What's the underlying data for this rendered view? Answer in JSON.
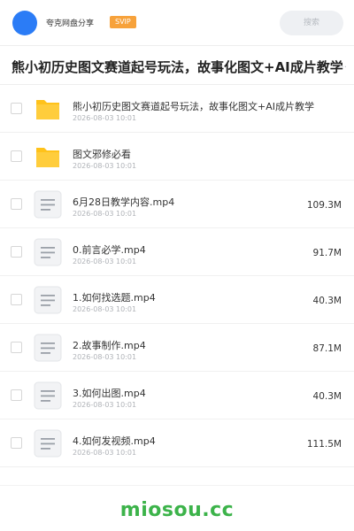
{
  "header": {
    "brand": "夸克网盘分享",
    "badge": "SVIP",
    "search_placeholder": "搜索"
  },
  "share": {
    "title": "熊小初历史图文赛道起号玩法，故事化图文+AI成片教学"
  },
  "files": [
    {
      "name": "熊小初历史图文赛道起号玩法，故事化图文+AI成片教学",
      "date": "2026-08-03 10:01",
      "size": "",
      "icon": "folder-icon"
    },
    {
      "name": "图文邪修必看",
      "date": "2026-08-03 10:01",
      "size": "",
      "icon": "folder-icon"
    },
    {
      "name": "6月28日教学内容.mp4",
      "date": "2026-08-03 10:01",
      "size": "109.3M",
      "icon": "video-file-icon"
    },
    {
      "name": "0.前言必学.mp4",
      "date": "2026-08-03 10:01",
      "size": "91.7M",
      "icon": "video-file-icon"
    },
    {
      "name": "1.如何找选题.mp4",
      "date": "2026-08-03 10:01",
      "size": "40.3M",
      "icon": "video-file-icon"
    },
    {
      "name": "2.故事制作.mp4",
      "date": "2026-08-03 10:01",
      "size": "87.1M",
      "icon": "video-file-icon"
    },
    {
      "name": "3.如何出图.mp4",
      "date": "2026-08-03 10:01",
      "size": "40.3M",
      "icon": "video-file-icon"
    },
    {
      "name": "4.如何发视频.mp4",
      "date": "2026-08-03 10:01",
      "size": "111.5M",
      "icon": "video-file-icon"
    }
  ],
  "watermark": "miosou.cc",
  "colors": {
    "avatar": "#2b7cf6",
    "badge": "#f7a23b",
    "folder": "#ffc21a",
    "watermark": "#3cb34a"
  }
}
